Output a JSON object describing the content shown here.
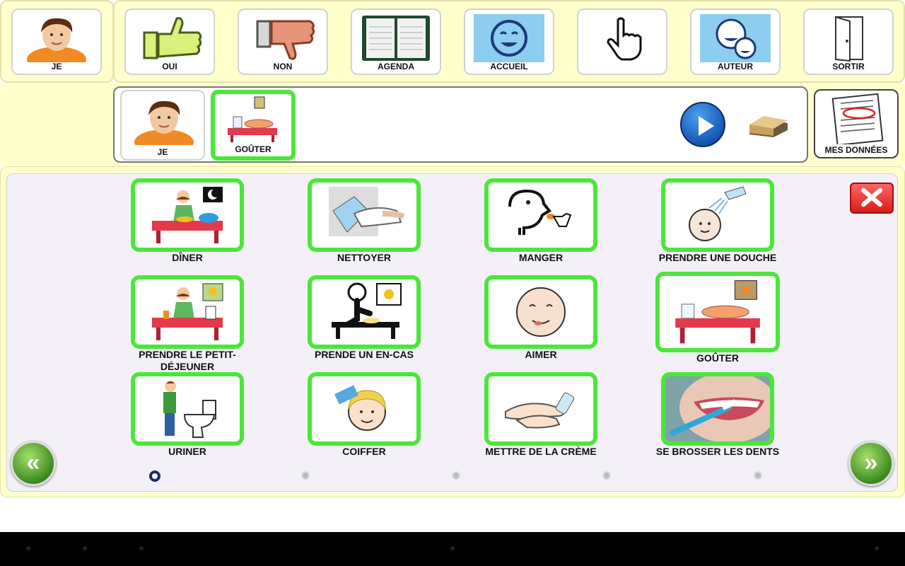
{
  "top_panel": {
    "self": {
      "label": "JE",
      "icon": "boy-face-icon"
    },
    "items": [
      {
        "label": "OUI",
        "icon": "thumbs-up-icon"
      },
      {
        "label": "NON",
        "icon": "thumbs-down-icon"
      },
      {
        "label": "AGENDA",
        "icon": "agenda-icon"
      },
      {
        "label": "ACCUEIL",
        "icon": "home-smiley-icon"
      },
      {
        "label": "",
        "icon": "hand-pointer-icon"
      },
      {
        "label": "AUTEUR",
        "icon": "author-faces-icon"
      },
      {
        "label": "SORTIR",
        "icon": "exit-door-icon"
      }
    ]
  },
  "sentence_bar": {
    "items": [
      {
        "label": "JE",
        "icon": "boy-face-icon"
      },
      {
        "label": "GOÛTER",
        "icon": "snack-table-icon"
      }
    ],
    "play_icon": "play-icon",
    "erase_icon": "eraser-icon"
  },
  "my_data": {
    "label": "MES DONNÉES",
    "icon": "document-icon"
  },
  "grid": {
    "close_icon": "close-icon",
    "cards": [
      {
        "label": "DÎNER",
        "icon": "dinner-icon"
      },
      {
        "label": "NETTOYER",
        "icon": "cleaning-icon"
      },
      {
        "label": "MANGER",
        "icon": "eating-icon"
      },
      {
        "label": "PRENDRE UNE DOUCHE",
        "icon": "shower-icon"
      },
      {
        "label": "PRENDRE LE PETIT-DÉJEUNER",
        "icon": "breakfast-icon"
      },
      {
        "label": "PRENDE UN EN-CAS",
        "icon": "snack-icon"
      },
      {
        "label": "AIMER",
        "icon": "like-face-icon"
      },
      {
        "label": "GOÛTER",
        "icon": "snack-table-icon"
      },
      {
        "label": "URINER",
        "icon": "toilet-icon"
      },
      {
        "label": "COIFFER",
        "icon": "comb-hair-icon"
      },
      {
        "label": "METTRE DE LA CRÈME",
        "icon": "cream-hands-icon"
      },
      {
        "label": "SE BROSSER LES DENTS",
        "icon": "toothbrush-icon"
      }
    ],
    "prev_icon": "double-chevron-left-icon",
    "next_icon": "double-chevron-right-icon",
    "pages": 5,
    "current_page": 1
  },
  "colors": {
    "accent_green": "#4ce63a",
    "panel_yellow": "#ffffcc",
    "close_red": "#e82a2a"
  }
}
